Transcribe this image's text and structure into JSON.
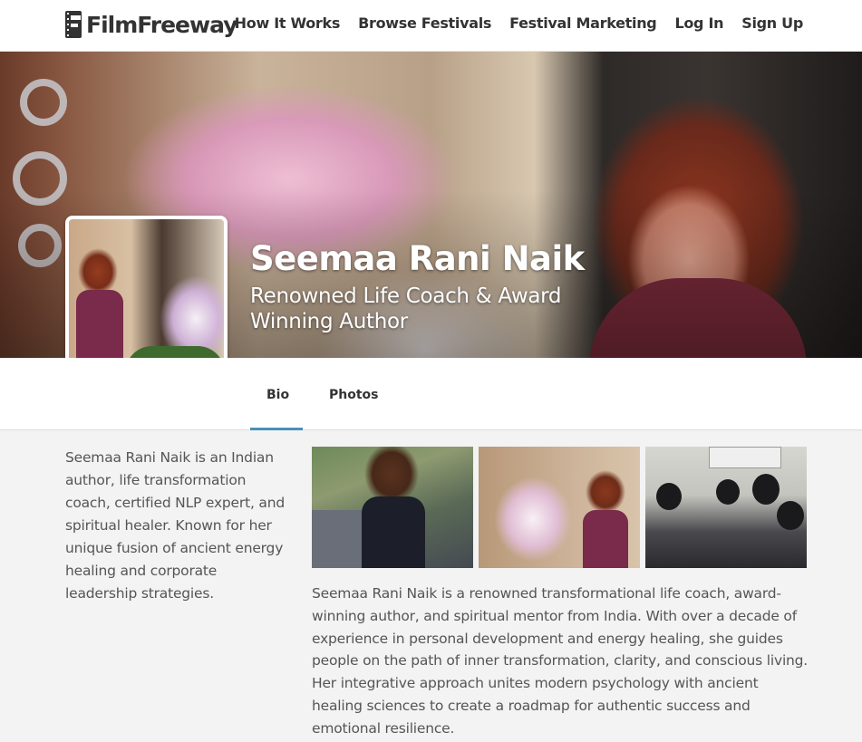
{
  "header": {
    "logo_text": "FilmFreeway",
    "nav": [
      "How It Works",
      "Browse Festivals",
      "Festival Marketing",
      "Log In",
      "Sign Up"
    ]
  },
  "profile": {
    "name": "Seemaa Rani Naik",
    "tagline": "Renowned Life Coach & Award Winning Author"
  },
  "tabs": [
    {
      "label": "Bio",
      "active": true
    },
    {
      "label": "Photos",
      "active": false
    }
  ],
  "short_bio": "Seemaa Rani Naik is an Indian author, life transformation coach, certified NLP expert, and spiritual healer. Known for her unique fusion of ancient energy healing and corporate leadership strategies.",
  "long_bio": "Seemaa Rani Naik is a renowned transformational life coach, award-winning author, and spiritual mentor from India. With over a decade of experience in personal development and energy healing, she guides people on the path of inner transformation, clarity, and conscious living. Her integrative approach unites modern psychology with ancient healing sciences to create a roadmap for authentic success and emotional resilience.",
  "colors": {
    "accent": "#4a90b8",
    "text": "#333333",
    "muted_text": "#555555",
    "page_background": "#f3f3f3"
  }
}
